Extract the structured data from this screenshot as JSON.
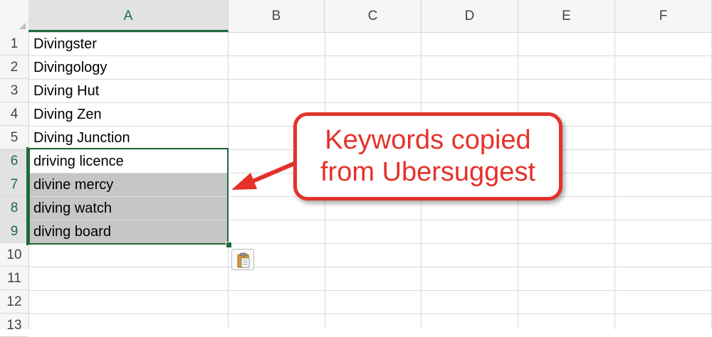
{
  "spreadsheet": {
    "columns": [
      "A",
      "B",
      "C",
      "D",
      "E",
      "F"
    ],
    "active_column": "A",
    "rows": [
      "1",
      "2",
      "3",
      "4",
      "5",
      "6",
      "7",
      "8",
      "9",
      "10",
      "11",
      "12",
      "13"
    ],
    "active_rows": [
      "6",
      "7",
      "8",
      "9"
    ],
    "cells_A": [
      "Divingster",
      "Divingology",
      "Diving Hut",
      "Diving Zen",
      "Diving Junction",
      "driving licence",
      "divine mercy",
      "diving watch",
      "diving board"
    ],
    "selected_range": "A6:A9",
    "paste_options_icon": "clipboard-icon"
  },
  "callout": {
    "line1": "Keywords copied",
    "line2": "from Ubersuggest",
    "color": "#e4322b"
  },
  "colors": {
    "selection_green": "#1e6b3a",
    "cell_fill_gray": "#c6c6c6",
    "header_bg": "#f6f6f6"
  }
}
